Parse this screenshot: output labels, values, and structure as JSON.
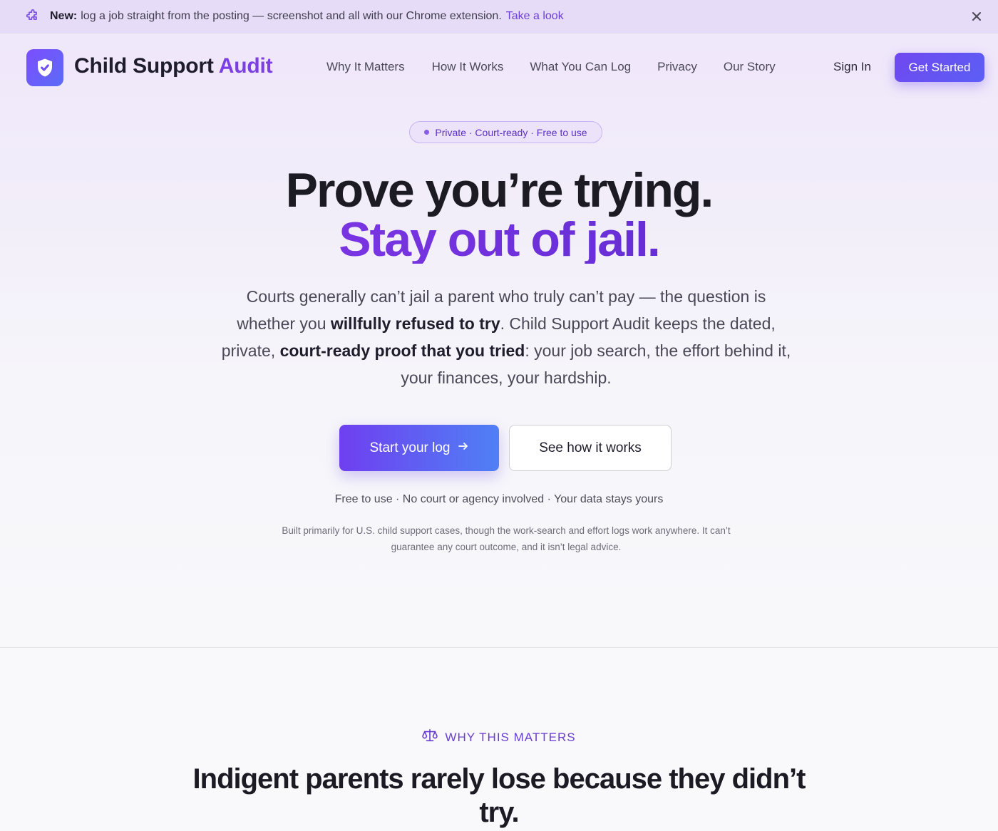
{
  "announcement": {
    "icon": "puzzle-icon",
    "label": "New:",
    "text": "log a job straight from the posting — screenshot and all with our Chrome extension.",
    "link": "Take a look"
  },
  "nav": {
    "brand_main": "Child Support",
    "brand_accent": "Audit",
    "links": [
      "Why It Matters",
      "How It Works",
      "What You Can Log",
      "Privacy",
      "Our Story"
    ],
    "sign_in": "Sign In",
    "get_started": "Get Started"
  },
  "hero": {
    "pill": "Private · Court-ready · Free to use",
    "headline_1": "Prove you’re trying.",
    "headline_2": "Stay out of jail.",
    "lede_a": "Courts generally can’t jail a parent who truly can’t pay — the question is whether you ",
    "lede_b": "willfully refused to try",
    "lede_c": ". Child Support Audit keeps the dated, private, ",
    "lede_d": "court-ready proof that you tried",
    "lede_e": ": your job search, the effort behind it, your finances, your hardship.",
    "cta_primary": "Start your log",
    "cta_secondary": "See how it works",
    "subnote": "Free to use · No court or agency involved · Your data stays yours",
    "fine_print": "Built primarily for U.S. child support cases, though the work-search and effort logs work anywhere. It can’t guarantee any court outcome, and it isn’t legal advice."
  },
  "why": {
    "eyebrow": "WHY THIS MATTERS",
    "headline": "Indigent parents rarely lose because they didn’t try."
  },
  "colors": {
    "accent": "#7b3fe4",
    "banner_bg": "#e6dcf7",
    "button_gradient_start": "#6f3ff0",
    "button_gradient_end": "#4f80f5"
  }
}
